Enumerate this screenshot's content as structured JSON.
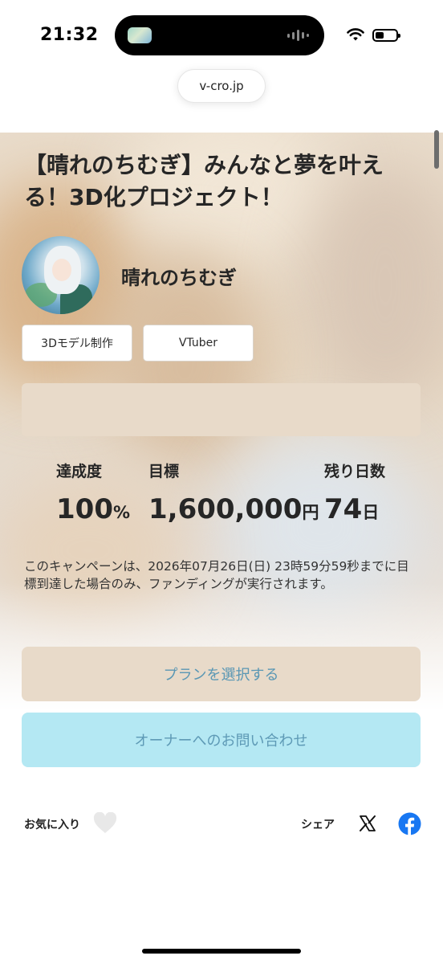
{
  "status_bar": {
    "time": "21:32",
    "icons": [
      "dynamic-island",
      "audio-wave-icon",
      "wifi-icon",
      "battery-icon"
    ],
    "battery_level": 0.3
  },
  "browser": {
    "url": "v-cro.jp"
  },
  "project": {
    "title": "【晴れのちむぎ】みんなと夢を叶える！3D化プロジェクト！",
    "owner_name": "晴れのちむぎ",
    "tags": [
      "3Dモデル制作",
      "VTuber"
    ]
  },
  "stats": {
    "achievement": {
      "label": "達成度",
      "value": "100",
      "unit": "%"
    },
    "goal": {
      "label": "目標",
      "value": "1,600,000",
      "unit": "円"
    },
    "days_left": {
      "label": "残り日数",
      "value": "74",
      "unit": "日"
    }
  },
  "notice": "このキャンペーンは、2026年07月26日(日) 23時59分59秒までに目標到達した場合のみ、ファンディングが実行されます。",
  "actions": {
    "select_plan": "プランを選択する",
    "contact_owner": "オーナーへのお問い合わせ"
  },
  "footer": {
    "favorite_label": "お気に入り",
    "share_label": "シェア",
    "share_icons": [
      "x-icon",
      "facebook-icon"
    ]
  },
  "colors": {
    "plan_button_bg": "#e8dac9",
    "plan_button_text": "#5a97b4",
    "contact_button_bg": "#b4e8f3",
    "contact_button_text": "#5e9ab6",
    "facebook_blue": "#1877f2"
  }
}
